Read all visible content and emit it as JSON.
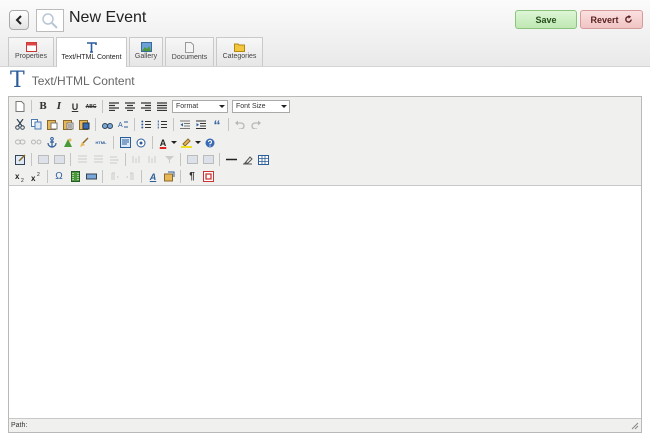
{
  "header": {
    "title": "New Event",
    "save_label": "Save",
    "revert_label": "Revert"
  },
  "tabs": [
    {
      "label": "Properties",
      "icon": "properties-icon"
    },
    {
      "label": "Text/HTML Content",
      "icon": "text-content-icon",
      "active": true
    },
    {
      "label": "Gallery",
      "icon": "gallery-icon"
    },
    {
      "label": "Documents",
      "icon": "documents-icon"
    },
    {
      "label": "Categories",
      "icon": "categories-icon"
    }
  ],
  "section": {
    "title": "Text/HTML Content",
    "icon_glyph": "T"
  },
  "editor": {
    "format_select": "Format",
    "fontsize_select": "Font Size",
    "status_label": "Path:",
    "toolbar_glyphs": {
      "bold": "B",
      "italic": "I",
      "underline": "U",
      "strike": "ABC",
      "html": "HTML",
      "font_color": "A",
      "pilcrow": "¶",
      "omega": "Ω",
      "quote": "“",
      "styles": "A"
    }
  },
  "colors": {
    "save": "#c4eabb",
    "revert": "#f3caca",
    "accent": "#2c5d9b"
  }
}
